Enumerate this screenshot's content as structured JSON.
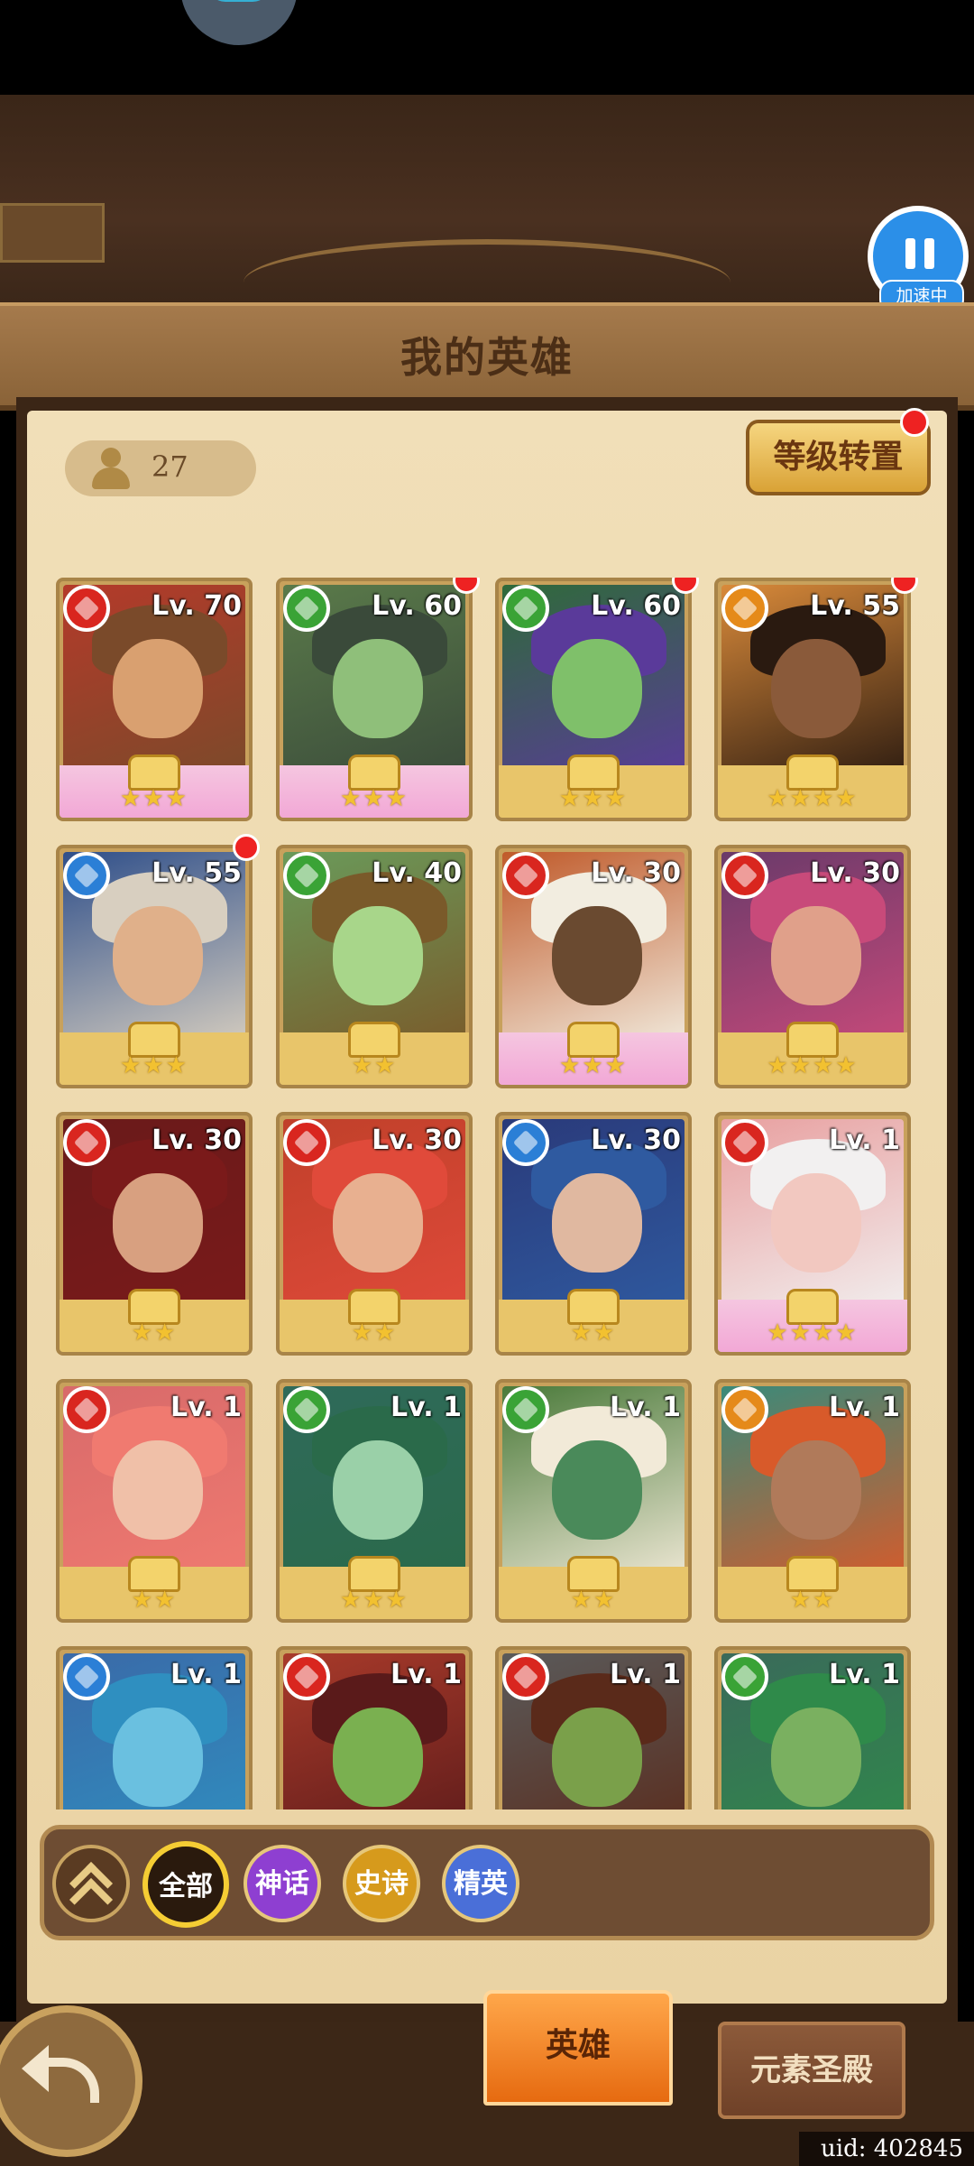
{
  "header": {
    "title": "我的英雄",
    "speed_label": "加速中"
  },
  "roster": {
    "count": "27",
    "level_reset_label": "等级转置"
  },
  "heroes": [
    {
      "level": "Lv. 70",
      "element": "fire",
      "stars": "★★★",
      "frame": "pink",
      "notify": false,
      "art": [
        "#b43a2a",
        "#7a4a2a",
        "#d9a070"
      ]
    },
    {
      "level": "Lv. 60",
      "element": "nature",
      "stars": "★★★",
      "frame": "pink",
      "notify": true,
      "art": [
        "#5a7a4a",
        "#3a4a3a",
        "#8fbf7a"
      ]
    },
    {
      "level": "Lv. 60",
      "element": "nature",
      "stars": "★★★",
      "frame": "gold",
      "notify": true,
      "art": [
        "#2f6a3a",
        "#5a3a9a",
        "#7fc06a"
      ]
    },
    {
      "level": "Lv. 55",
      "element": "earth",
      "stars": "★★★★",
      "frame": "gold",
      "notify": true,
      "art": [
        "#d98a3a",
        "#2a1a10",
        "#8a5a3a"
      ]
    },
    {
      "level": "Lv. 55",
      "element": "water",
      "stars": "★★★",
      "frame": "gold",
      "notify": true,
      "art": [
        "#2f4f8a",
        "#d8cfc0",
        "#e0b08a"
      ]
    },
    {
      "level": "Lv. 40",
      "element": "nature",
      "stars": "★★",
      "frame": "gold",
      "notify": false,
      "art": [
        "#6a9a5a",
        "#7a5a2a",
        "#a8d68a"
      ]
    },
    {
      "level": "Lv. 30",
      "element": "fire",
      "stars": "★★★",
      "frame": "pink",
      "notify": false,
      "art": [
        "#c05a2a",
        "#f2ede0",
        "#6a4a30"
      ]
    },
    {
      "level": "Lv. 30",
      "element": "fire",
      "stars": "★★★★",
      "frame": "gold",
      "notify": false,
      "art": [
        "#6a3a6a",
        "#c84a7a",
        "#e0a08a"
      ]
    },
    {
      "level": "Lv. 30",
      "element": "fire",
      "stars": "★★",
      "frame": "gold",
      "notify": false,
      "art": [
        "#6a1a1a",
        "#7a1a1a",
        "#d8a080"
      ]
    },
    {
      "level": "Lv. 30",
      "element": "fire",
      "stars": "★★",
      "frame": "gold",
      "notify": false,
      "art": [
        "#c0402a",
        "#e04a3a",
        "#e8b090"
      ]
    },
    {
      "level": "Lv. 30",
      "element": "water",
      "stars": "★★",
      "frame": "gold",
      "notify": false,
      "art": [
        "#2a3a7a",
        "#2f5aa0",
        "#e0b8a0"
      ]
    },
    {
      "level": "Lv. 1",
      "element": "fire",
      "stars": "★★★★",
      "frame": "pink",
      "notify": false,
      "art": [
        "#e8a0a0",
        "#f2f0f0",
        "#f2c8c0"
      ]
    },
    {
      "level": "Lv. 1",
      "element": "fire",
      "stars": "★★",
      "frame": "gold",
      "notify": false,
      "art": [
        "#d86a6a",
        "#f07a70",
        "#f0c0a8"
      ]
    },
    {
      "level": "Lv. 1",
      "element": "nature",
      "stars": "★★★",
      "frame": "gold",
      "notify": false,
      "art": [
        "#2f6a5a",
        "#2a6a4a",
        "#9ad0a8"
      ]
    },
    {
      "level": "Lv. 1",
      "element": "nature",
      "stars": "★★",
      "frame": "gold",
      "notify": false,
      "art": [
        "#4a7a3a",
        "#f2ead8",
        "#4a8a5a"
      ]
    },
    {
      "level": "Lv. 1",
      "element": "earth",
      "stars": "★★",
      "frame": "gold",
      "notify": false,
      "art": [
        "#3a8a7a",
        "#d85a2a",
        "#b07a5a"
      ]
    },
    {
      "level": "Lv. 1",
      "element": "water",
      "stars": "",
      "frame": "gold",
      "notify": false,
      "art": [
        "#3a6aa8",
        "#2f8fc0",
        "#6ac0e0"
      ]
    },
    {
      "level": "Lv. 1",
      "element": "fire",
      "stars": "",
      "frame": "gold",
      "notify": false,
      "art": [
        "#a83a2a",
        "#5a1a1a",
        "#7ab050"
      ]
    },
    {
      "level": "Lv. 1",
      "element": "fire",
      "stars": "",
      "frame": "gold",
      "notify": false,
      "art": [
        "#5a5a5a",
        "#5a2a1a",
        "#7aa04a"
      ]
    },
    {
      "level": "Lv. 1",
      "element": "nature",
      "stars": "",
      "frame": "gold",
      "notify": false,
      "art": [
        "#3a6a5a",
        "#2f8a4a",
        "#7ab060"
      ]
    }
  ],
  "filters": {
    "all": "全部",
    "myth": "神话",
    "epic": "史诗",
    "elite": "精英"
  },
  "nav": {
    "heroes_tab": "英雄",
    "element_tab": "元素圣殿"
  },
  "footer": {
    "uid": "uid: 402845"
  }
}
